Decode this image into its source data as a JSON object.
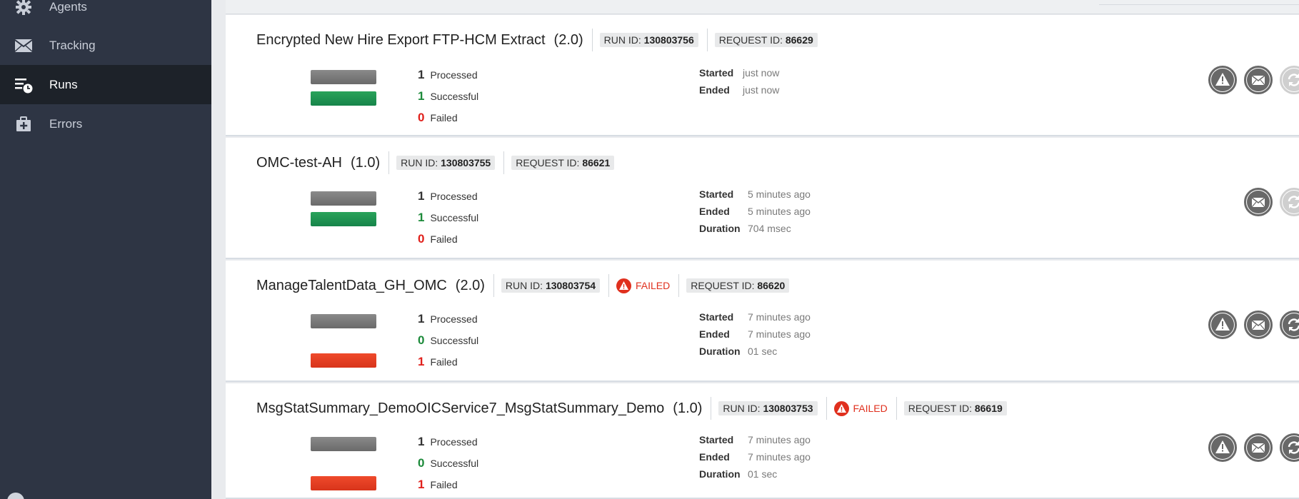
{
  "sidebar": {
    "items": [
      {
        "label": "Agents",
        "icon": "gear-icon",
        "active": false
      },
      {
        "label": "Tracking",
        "icon": "envelope-icon",
        "active": false
      },
      {
        "label": "Runs",
        "icon": "runs-list-clock-icon",
        "active": true
      },
      {
        "label": "Errors",
        "icon": "briefcase-plus-icon",
        "active": false
      }
    ]
  },
  "runs": [
    {
      "name": "Encrypted New Hire Export FTP-HCM Extract",
      "version": "(2.0)",
      "run_id_label": "RUN ID:",
      "run_id": "130803756",
      "request_id_label": "REQUEST ID:",
      "request_id": "86629",
      "failed_badge": null,
      "processed": "1",
      "processed_label": "Processed",
      "successful": "1",
      "successful_label": "Successful",
      "failed": "0",
      "failed_label": "Failed",
      "started_label": "Started",
      "started": "just now",
      "ended_label": "Ended",
      "ended": "just now",
      "duration_label": null,
      "duration": null
    },
    {
      "name": "OMC-test-AH",
      "version": "(1.0)",
      "run_id_label": "RUN ID:",
      "run_id": "130803755",
      "request_id_label": "REQUEST ID:",
      "request_id": "86621",
      "failed_badge": null,
      "processed": "1",
      "processed_label": "Processed",
      "successful": "1",
      "successful_label": "Successful",
      "failed": "0",
      "failed_label": "Failed",
      "started_label": "Started",
      "started": "5 minutes ago",
      "ended_label": "Ended",
      "ended": "5 minutes ago",
      "duration_label": "Duration",
      "duration": "704 msec"
    },
    {
      "name": "ManageTalentData_GH_OMC",
      "version": "(2.0)",
      "run_id_label": "RUN ID:",
      "run_id": "130803754",
      "request_id_label": "REQUEST ID:",
      "request_id": "86620",
      "failed_badge": "FAILED",
      "processed": "1",
      "processed_label": "Processed",
      "successful": "0",
      "successful_label": "Successful",
      "failed": "1",
      "failed_label": "Failed",
      "started_label": "Started",
      "started": "7 minutes ago",
      "ended_label": "Ended",
      "ended": "7 minutes ago",
      "duration_label": "Duration",
      "duration": "01 sec"
    },
    {
      "name": "MsgStatSummary_DemoOICService7_MsgStatSummary_Demo",
      "version": "(1.0)",
      "run_id_label": "RUN ID:",
      "run_id": "130803753",
      "request_id_label": "REQUEST ID:",
      "request_id": "86619",
      "failed_badge": "FAILED",
      "processed": "1",
      "processed_label": "Processed",
      "successful": "0",
      "successful_label": "Successful",
      "failed": "1",
      "failed_label": "Failed",
      "started_label": "Started",
      "started": "7 minutes ago",
      "ended_label": "Ended",
      "ended": "7 minutes ago",
      "duration_label": "Duration",
      "duration": "01 sec"
    }
  ],
  "colors": {
    "sidebar_bg": "#2e3544",
    "sidebar_active_bg": "#1d2229",
    "success_green": "#1c8a3a",
    "failed_red": "#e0301e",
    "processed_gray": "#747474"
  }
}
